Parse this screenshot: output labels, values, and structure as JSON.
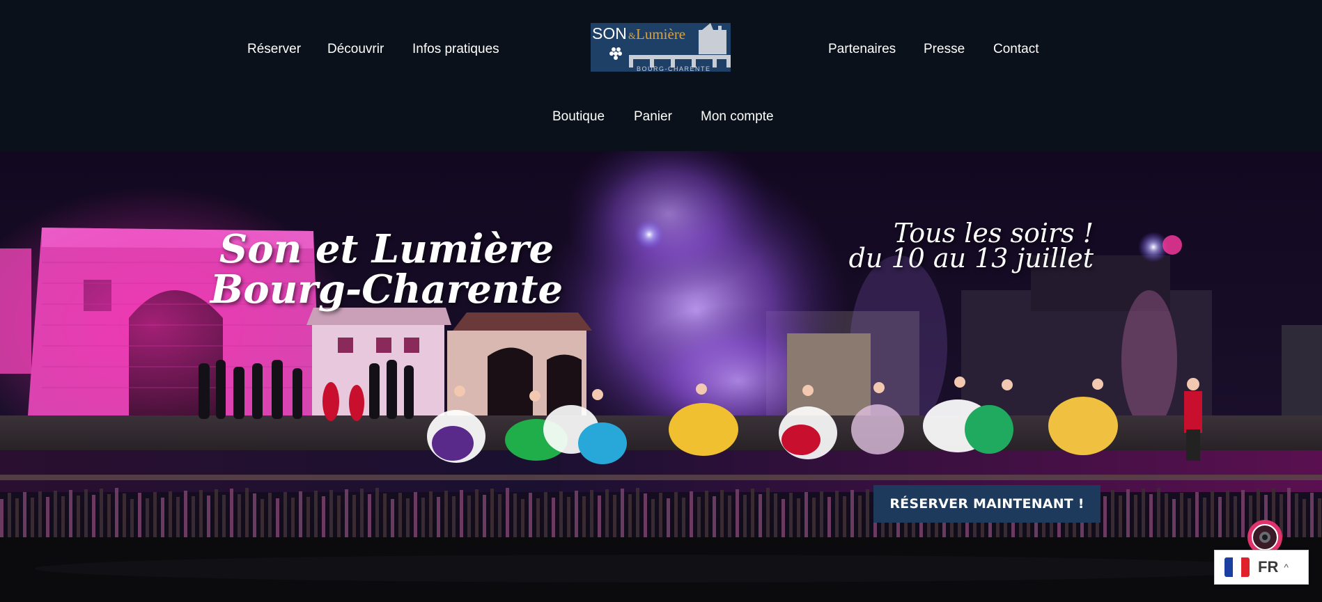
{
  "nav": {
    "left": [
      {
        "label": "Réserver"
      },
      {
        "label": "Découvrir"
      },
      {
        "label": "Infos pratiques"
      }
    ],
    "right": [
      {
        "label": "Partenaires"
      },
      {
        "label": "Presse"
      },
      {
        "label": "Contact"
      }
    ],
    "secondary": [
      {
        "label": "Boutique"
      },
      {
        "label": "Panier"
      },
      {
        "label": "Mon compte"
      }
    ]
  },
  "logo": {
    "son": "SON",
    "amp": "&",
    "lumiere": "Lumière",
    "place": "BOURG-CHARENTE"
  },
  "hero": {
    "title_line1": "Son et Lumière",
    "title_line2": "Bourg-Charente",
    "dates_line1": "Tous les soirs !",
    "dates_line2": "du 10 au 13 juillet",
    "cta_label": "RÉSERVER MAINTENANT !"
  },
  "language": {
    "current": "FR",
    "chevron": "^"
  },
  "colors": {
    "header_bg": "#0a111a",
    "cta_bg": "#1d3a5c",
    "logo_blue": "#1e3f66",
    "logo_gold": "#d4a34a",
    "accessibility_pink": "#e0336b"
  },
  "icons": {
    "accessibility": "accessibility-eye-icon",
    "flag": "france-flag-icon",
    "chevron": "chevron-up-icon"
  }
}
